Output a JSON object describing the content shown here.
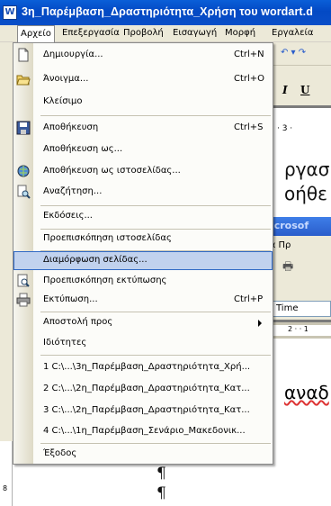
{
  "window": {
    "title": "3η_Παρέμβαση_Δραστηριότητα_Χρήση του wordart.d",
    "app_icon_glyph": "W"
  },
  "menubar": {
    "items": [
      {
        "label": "Αρχείο"
      },
      {
        "label": "Επεξεργασία"
      },
      {
        "label": "Προβολή"
      },
      {
        "label": "Εισαγωγή"
      },
      {
        "label": "Μορφή"
      },
      {
        "label": "Εργαλεία"
      }
    ]
  },
  "file_menu": {
    "items": [
      {
        "label": "Δημιουργία...",
        "shortcut": "Ctrl+N",
        "icon": "new-document-icon"
      },
      {
        "label": "Άνοιγμα...",
        "shortcut": "Ctrl+O",
        "icon": "open-folder-icon"
      },
      {
        "label": "Κλείσιμο",
        "shortcut": "",
        "icon": ""
      },
      {
        "label": "Αποθήκευση",
        "shortcut": "Ctrl+S",
        "icon": "save-disk-icon"
      },
      {
        "label": "Αποθήκευση ως...",
        "shortcut": "",
        "icon": ""
      },
      {
        "label": "Αποθήκευση ως ιστοσελίδας...",
        "shortcut": "",
        "icon": "save-as-web-icon"
      },
      {
        "label": "Αναζήτηση...",
        "shortcut": "",
        "icon": "search-file-icon"
      },
      {
        "label": "Εκδόσεις...",
        "shortcut": "",
        "icon": ""
      },
      {
        "label": "Προεπισκόπηση ιστοσελίδας",
        "shortcut": "",
        "icon": ""
      },
      {
        "label": "Διαμόρφωση σελίδας...",
        "shortcut": "",
        "icon": "",
        "highlighted": true
      },
      {
        "label": "Προεπισκόπηση εκτύπωσης",
        "shortcut": "",
        "icon": "print-preview-icon"
      },
      {
        "label": "Εκτύπωση...",
        "shortcut": "Ctrl+P",
        "icon": "printer-icon"
      },
      {
        "label": "Αποστολή προς",
        "shortcut": "",
        "icon": "",
        "submenu": true
      },
      {
        "label": "Ιδιότητες",
        "shortcut": "",
        "icon": ""
      },
      {
        "label": "1 C:\\...\\3η_Παρέμβαση_Δραστηριότητα_Χρή...",
        "shortcut": "",
        "icon": ""
      },
      {
        "label": "2 C:\\...\\2η_Παρέμβαση_Δραστηριότητα_Κατ...",
        "shortcut": "",
        "icon": ""
      },
      {
        "label": "3 C:\\...\\2η_Παρέμβαση_Δραστηριότητα_Κατ...",
        "shortcut": "",
        "icon": ""
      },
      {
        "label": "4 C:\\...\\1η_Παρέμβαση_Σενάριο_Μακεδονικ...",
        "shortcut": "",
        "icon": ""
      },
      {
        "label": "Έξοδος",
        "shortcut": "",
        "icon": ""
      }
    ]
  },
  "background": {
    "doc_text_1": "ργασ",
    "doc_text_2": "οήθε",
    "doc_text_3": "αναδ",
    "ms_bar": "Microsof",
    "menu2_text": "σία   Πρ",
    "font_box": "Time",
    "ruler_marks": "· 3 ·",
    "ruler2_marks": "2 · · 1",
    "pilcrow": "¶"
  },
  "colors": {
    "titlebar": "#0349c4",
    "highlight": "#c1d2ee",
    "highlight_border": "#316ac5",
    "menu_bg": "#fcfcf9"
  }
}
